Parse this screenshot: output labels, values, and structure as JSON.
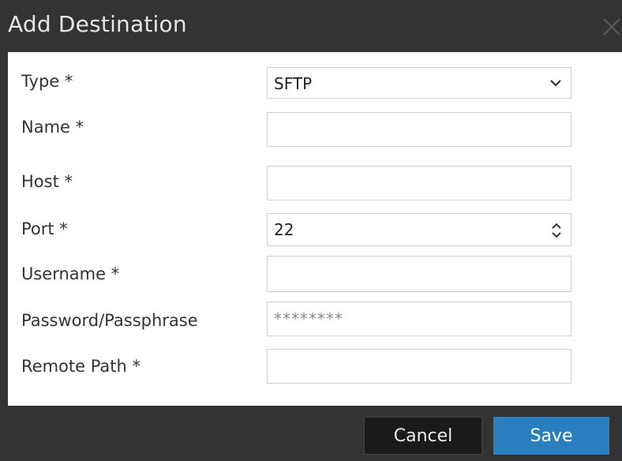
{
  "dialog": {
    "title": "Add Destination",
    "close_icon": "close-icon"
  },
  "form": {
    "type": {
      "label": "Type *",
      "value": "SFTP",
      "icon": "chevron-down-icon"
    },
    "name": {
      "label": "Name *",
      "value": ""
    },
    "host": {
      "label": "Host *",
      "value": ""
    },
    "port": {
      "label": "Port *",
      "value": "22",
      "icon": "spinner-icon"
    },
    "username": {
      "label": "Username *",
      "value": ""
    },
    "password": {
      "label": "Password/Passphrase",
      "value": "********"
    },
    "remote_path": {
      "label": "Remote Path *",
      "value": ""
    }
  },
  "footer": {
    "cancel_label": "Cancel",
    "save_label": "Save"
  },
  "colors": {
    "chrome": "#333333",
    "panel": "#ffffff",
    "primary": "#2a7fc0",
    "secondary_button": "#1a1a1a"
  }
}
